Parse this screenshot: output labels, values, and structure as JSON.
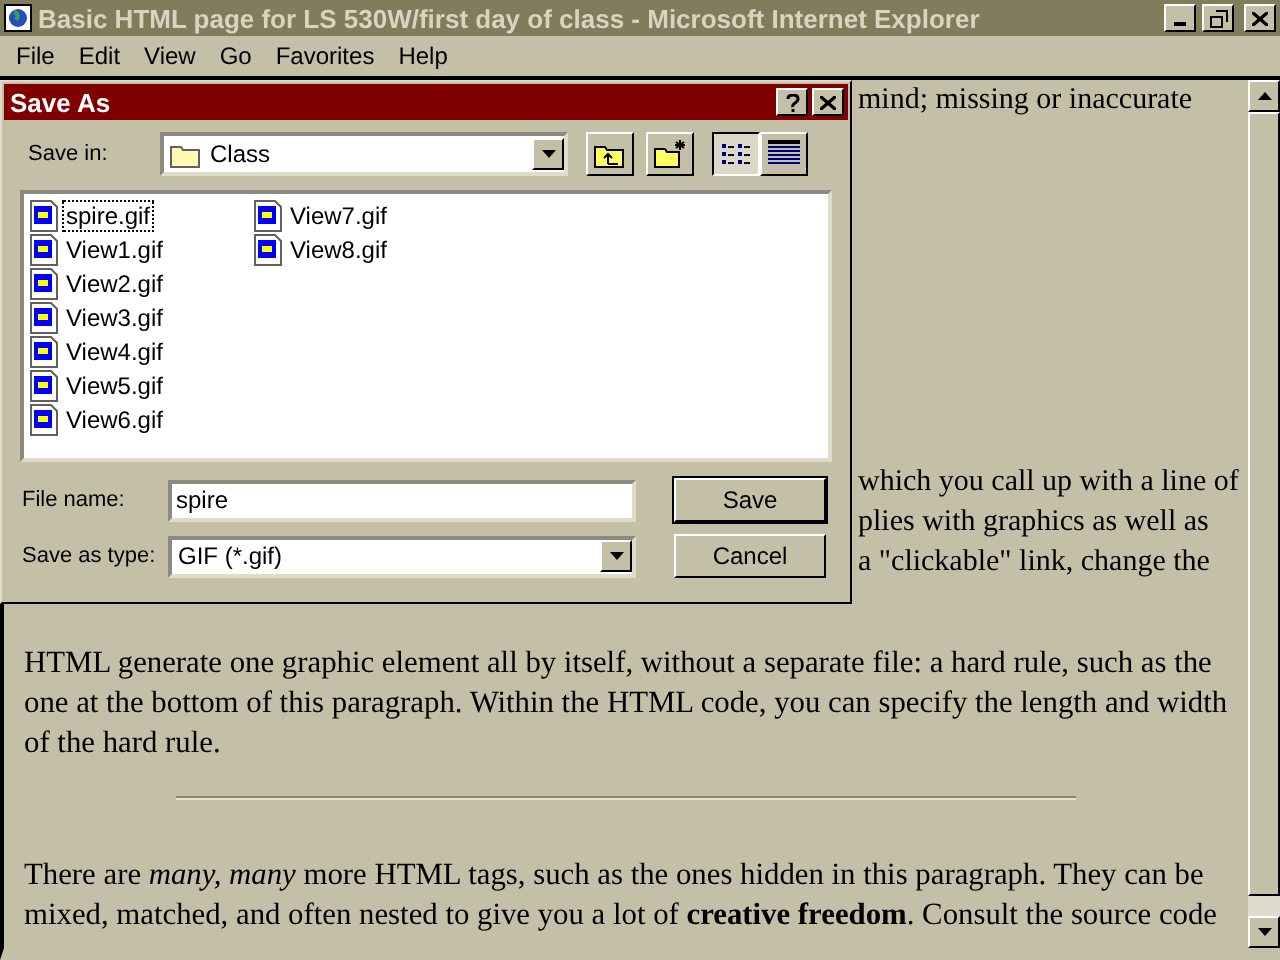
{
  "browser": {
    "title": "Basic HTML page for LS 530W/first day of class - Microsoft Internet Explorer",
    "menu": [
      "File",
      "Edit",
      "View",
      "Go",
      "Favorites",
      "Help"
    ],
    "page": {
      "fragments_top": [
        "mind; missing or inaccurate"
      ],
      "fragments_mid": [
        "which you call up with a line of",
        "plies with graphics as well as",
        "a \"clickable\" link, change the"
      ],
      "paragraphs": [
        "HTML generate one graphic element all by itself, without a separate file: a hard rule, such as the one at the bottom of this paragraph. Within the HTML code, you can specify the length and width of the hard rule.",
        "There are *many, many* more HTML tags, such as the ones hidden in this paragraph. They can be mixed, matched, and often nested to give you a lot of **creative freedom**. Consult the source code"
      ]
    }
  },
  "dialog": {
    "title": "Save As",
    "save_in_label": "Save in:",
    "save_in_value": "Class",
    "view_buttons": [
      {
        "kind": "list",
        "selected": true
      },
      {
        "kind": "details",
        "selected": false
      }
    ],
    "files": [
      {
        "name": "spire.gif",
        "selected": true
      },
      {
        "name": "View1.gif",
        "selected": false
      },
      {
        "name": "View2.gif",
        "selected": false
      },
      {
        "name": "View3.gif",
        "selected": false
      },
      {
        "name": "View4.gif",
        "selected": false
      },
      {
        "name": "View5.gif",
        "selected": false
      },
      {
        "name": "View6.gif",
        "selected": false
      },
      {
        "name": "View7.gif",
        "selected": false
      },
      {
        "name": "View8.gif",
        "selected": false
      }
    ],
    "file_name_label": "File name:",
    "file_name": "spire",
    "type_label": "Save as type:",
    "type_value": "GIF (*.gif)",
    "buttons": [
      "Save",
      "Cancel"
    ]
  }
}
